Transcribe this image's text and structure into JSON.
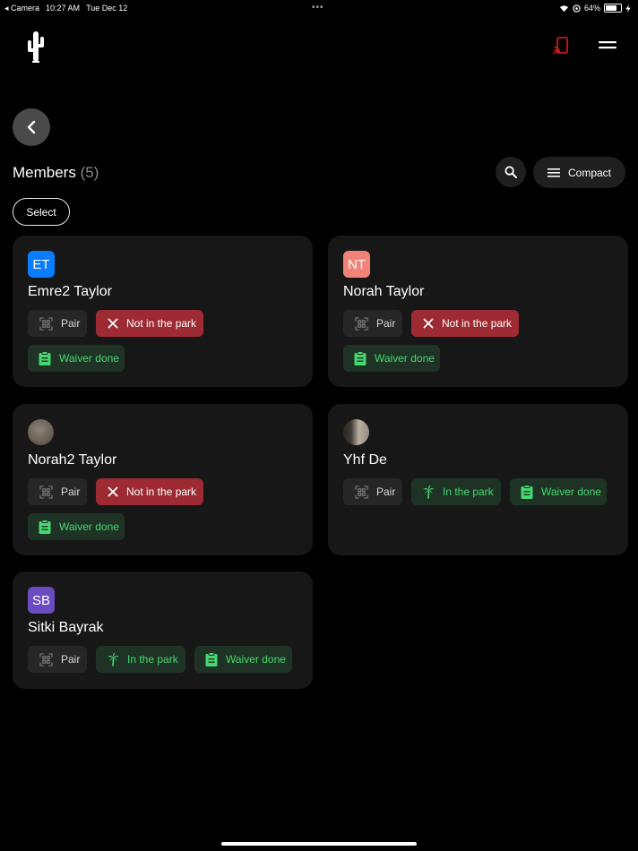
{
  "status_bar": {
    "back_app": "◂ Camera",
    "time": "10:27 AM",
    "date": "Tue Dec 12",
    "battery": "64%",
    "battery_level": 0.64
  },
  "header": {
    "logo_icon": "cactus-icon",
    "cast_icon": "cast-icon",
    "cast_color": "#e0201b",
    "menu_icon": "hamburger-menu-icon"
  },
  "toolbar": {
    "title": "Members",
    "count": "(5)",
    "search_icon": "search-icon",
    "compact_label": "Compact",
    "select_label": "Select"
  },
  "colors": {
    "not_in_park_bg": "#9e2a33",
    "green_text": "#47d770",
    "green_bg": "#1e3325",
    "card_bg": "#171717"
  },
  "labels": {
    "pair": "Pair",
    "not_in_park": "Not in the park",
    "in_park": "In the park",
    "waiver_done": "Waiver done"
  },
  "members": [
    {
      "initials": "ET",
      "avatar_color": "#0a7cff",
      "name": "Emre2 Taylor",
      "park_status": "not_in_park",
      "waiver": "done"
    },
    {
      "initials": "NT",
      "avatar_color": "#f08278",
      "name": "Norah Taylor",
      "park_status": "not_in_park",
      "waiver": "done"
    },
    {
      "initials": "",
      "avatar": "photo",
      "name": "Norah2 Taylor",
      "park_status": "not_in_park",
      "waiver": "done"
    },
    {
      "initials": "",
      "avatar": "photo",
      "name": "Yhf De",
      "park_status": "in_park",
      "waiver": "done"
    },
    {
      "initials": "SB",
      "avatar_color": "#6a4bc0",
      "name": "Sitki Bayrak",
      "park_status": "in_park",
      "waiver": "done"
    }
  ]
}
